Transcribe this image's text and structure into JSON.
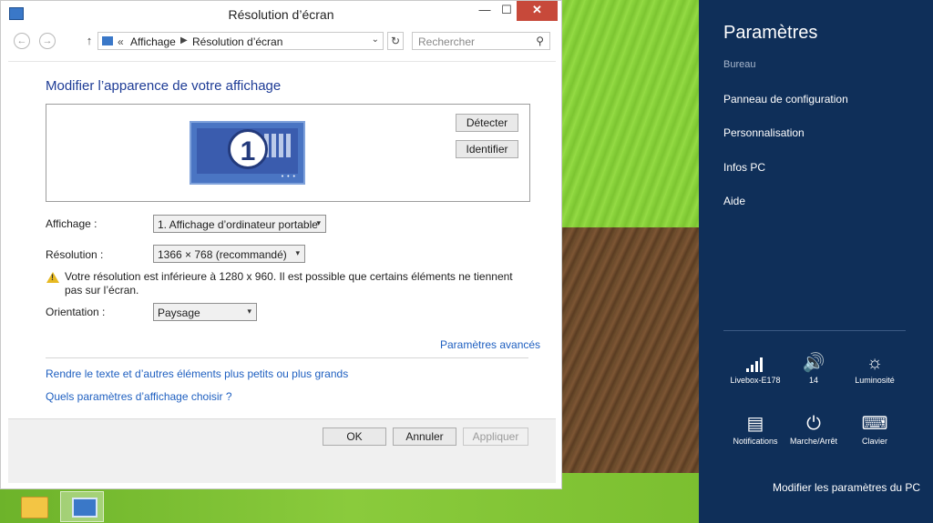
{
  "window": {
    "title": "Résolution d’écran",
    "controls": {
      "minimize": "—",
      "maximize": "☐",
      "close": "✕"
    }
  },
  "nav": {
    "back": "←",
    "forward": "→",
    "up": "↑",
    "breadcrumb_chevron": "«",
    "crumbs": [
      "Affichage",
      "Résolution d’écran"
    ],
    "crumb_sep": "▶",
    "dropdown": "⌄",
    "refresh": "↻",
    "search_placeholder": "Rechercher",
    "search_icon": "⚲"
  },
  "main": {
    "heading": "Modifier l’apparence de votre affichage",
    "monitor_number": "1",
    "monitor_dots": "• • •",
    "detect_button": "Détecter",
    "identify_button": "Identifier",
    "display_label": "Affichage :",
    "display_value": "1. Affichage d’ordinateur portable",
    "resolution_label": "Résolution :",
    "resolution_value": "1366 × 768 (recommandé)",
    "warning_text": "Votre résolution est inférieure à 1280 x 960. Il est possible que certains éléments ne tiennent pas sur l’écran.",
    "warning_mark": "!",
    "orientation_label": "Orientation :",
    "orientation_value": "Paysage",
    "advanced_link": "Paramètres avancés",
    "link_text_size": "Rendre le texte et d’autres éléments plus petits ou plus grands",
    "link_which_settings": "Quels paramètres d’affichage choisir ?",
    "select_arrow": "▾"
  },
  "footer": {
    "ok": "OK",
    "cancel": "Annuler",
    "apply": "Appliquer"
  },
  "charms": {
    "title": "Paramètres",
    "subtitle": "Bureau",
    "items": [
      "Panneau de configuration",
      "Personnalisation",
      "Infos PC",
      "Aide"
    ],
    "tiles": [
      {
        "label": "Livebox-E178",
        "icon": "network-icon"
      },
      {
        "label": "14",
        "icon": "volume-icon",
        "glyph": "🔊"
      },
      {
        "label": "Luminosité",
        "icon": "brightness-icon",
        "glyph": "☼"
      },
      {
        "label": "Notifications",
        "icon": "notifications-icon",
        "glyph": "▤"
      },
      {
        "label": "Marche/Arrêt",
        "icon": "power-icon",
        "glyph": "⏻"
      },
      {
        "label": "Clavier",
        "icon": "keyboard-icon",
        "glyph": "⌨"
      }
    ],
    "change_pc_settings": "Modifier les paramètres du PC"
  },
  "colors": {
    "charms_bg": "#0f2f59",
    "link_blue": "#1e5fc0",
    "heading_blue": "#1e3c96",
    "close_red": "#c7493a"
  }
}
